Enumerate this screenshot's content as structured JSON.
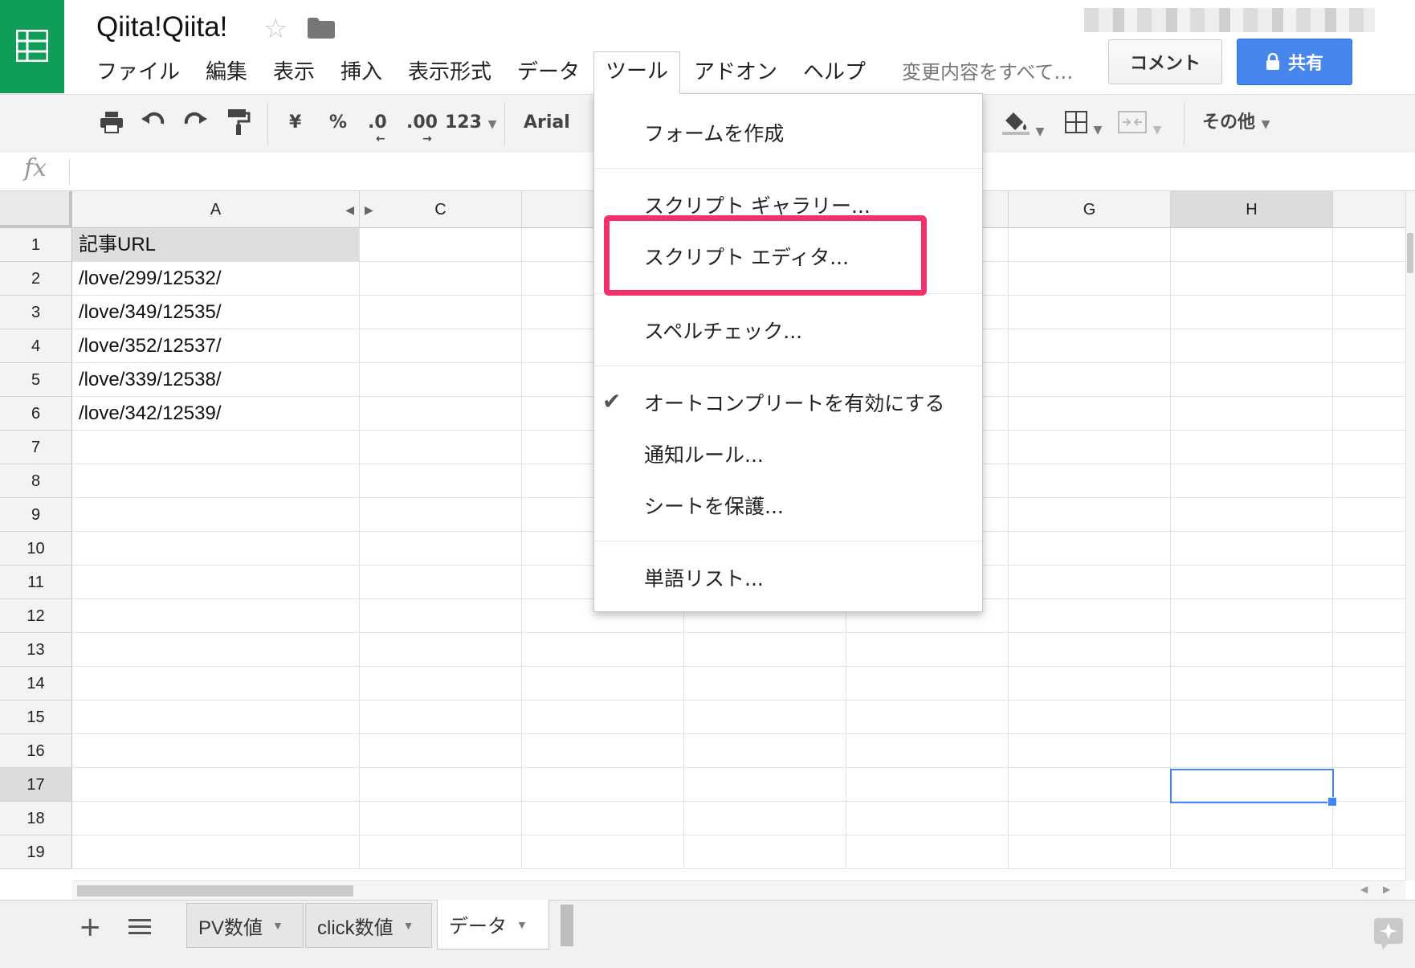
{
  "title": "Qiita!Qiita!",
  "menu": [
    "ファイル",
    "編集",
    "表示",
    "挿入",
    "表示形式",
    "データ",
    "ツール",
    "アドオン",
    "ヘルプ"
  ],
  "save_status": "変更内容をすべて…",
  "buttons": {
    "comment": "コメント",
    "share": "共有"
  },
  "toolbar": {
    "currency": "¥",
    "percent": "%",
    "dec_decrease": ".0",
    "dec_increase": ".00",
    "format_more": "123",
    "font": "Arial",
    "more": "その他"
  },
  "formula_icon": "fx",
  "columns": [
    "A",
    "C",
    "G",
    "H"
  ],
  "rows": [
    "1",
    "2",
    "3",
    "4",
    "5",
    "6",
    "7",
    "8",
    "9",
    "10",
    "11",
    "12",
    "13",
    "14",
    "15",
    "16",
    "17",
    "18",
    "19"
  ],
  "cells": [
    "記事URL",
    "/love/299/12532/",
    "/love/349/12535/",
    "/love/352/12537/",
    "/love/339/12538/",
    "/love/342/12539/"
  ],
  "tools_menu": [
    "フォームを作成",
    "スクリプト ギャラリー...",
    "スクリプト エディタ...",
    "スペルチェック...",
    "オートコンプリートを有効にする",
    "通知ルール...",
    "シートを保護...",
    "単語リスト..."
  ],
  "sheets": [
    "PV数値",
    "click数値",
    "データ"
  ],
  "colors": {
    "brand_green": "#0f9d58",
    "share_blue": "#4787ed",
    "highlight": "#f4306b",
    "selection": "#4285f4"
  }
}
